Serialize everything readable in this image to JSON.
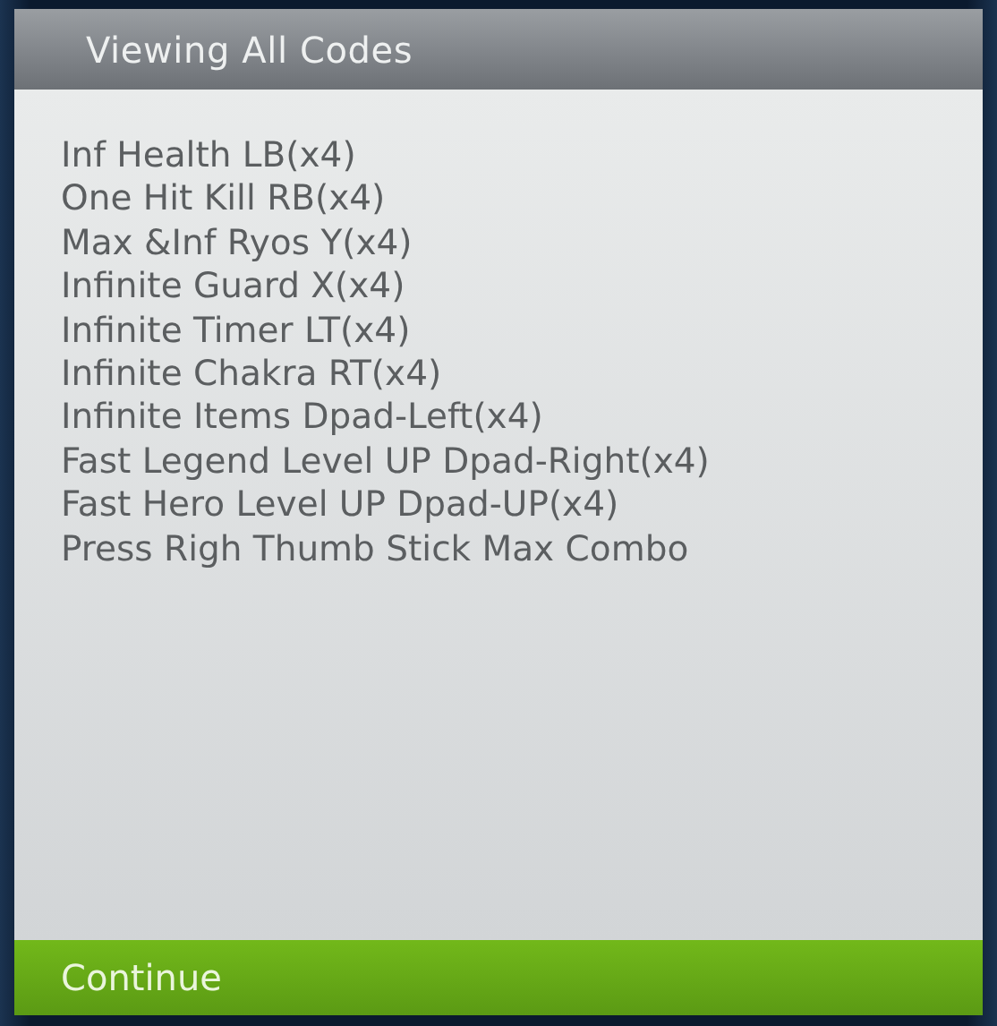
{
  "dialog": {
    "title": "Viewing All Codes",
    "codes": [
      "Inf Health LB(x4)",
      "One Hit Kill RB(x4)",
      "Max &Inf Ryos Y(x4)",
      "Infinite Guard X(x4)",
      "Infinite Timer LT(x4)",
      "Infinite Chakra RT(x4)",
      "Infinite Items Dpad-Left(x4)",
      "Fast Legend Level UP Dpad-Right(x4)",
      "Fast Hero Level UP Dpad-UP(x4)",
      "Press Righ Thumb Stick Max Combo"
    ],
    "button": "Continue"
  }
}
